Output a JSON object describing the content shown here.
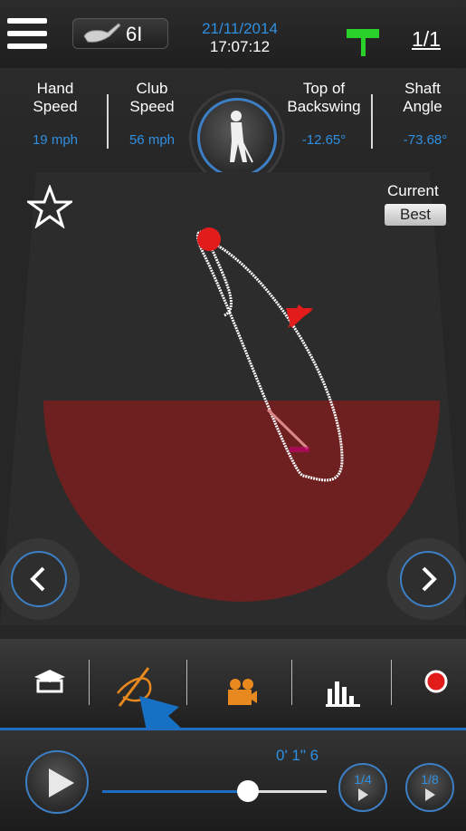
{
  "header": {
    "club": "6I",
    "date": "21/11/2014",
    "time": "17:07:12",
    "page_count": "1/1"
  },
  "stats": {
    "hand_speed": {
      "label_line1": "Hand",
      "label_line2": "Speed",
      "value": "19 mph"
    },
    "club_speed": {
      "label_line1": "Club",
      "label_line2": "Speed",
      "value": "56 mph"
    },
    "top_of_backswing": {
      "label_line1": "Top of",
      "label_line2": "Backswing",
      "value": "-12.65°"
    },
    "shaft_angle": {
      "label_line1": "Shaft",
      "label_line2": "Angle",
      "value": "-73.68°"
    }
  },
  "view": {
    "current_label": "Current",
    "best_label": "Best"
  },
  "toolbar": {
    "items": [
      "home-icon",
      "swing-path-icon",
      "video-camera-icon",
      "bar-chart-icon",
      "record-icon"
    ],
    "selected": "swing-path-icon"
  },
  "playback": {
    "timecode": "0' 1\" 6",
    "progress": 0.65,
    "speed_quarter": "1/4",
    "speed_eighth": "1/8"
  },
  "colors": {
    "accent_blue": "#2f8fe0",
    "swing_zone": "#6e1f1f",
    "marker_red": "#e21b1b",
    "flag_green": "#2ad12a",
    "tool_orange": "#e8891f"
  }
}
